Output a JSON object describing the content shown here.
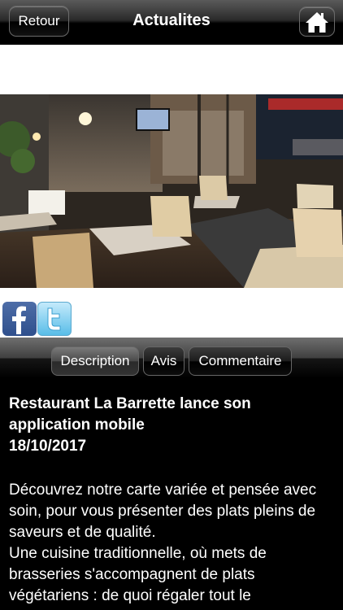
{
  "navbar": {
    "back_label": "Retour",
    "title": "Actualites",
    "home_icon": "home-icon"
  },
  "social": {
    "facebook_icon": "facebook-icon",
    "twitter_icon": "twitter-icon"
  },
  "tabs": [
    {
      "label": "Description",
      "active": true
    },
    {
      "label": "Avis",
      "active": false
    },
    {
      "label": "Commentaire",
      "active": false
    }
  ],
  "article": {
    "title": "Restaurant La Barrette lance son application mobile",
    "date": "18/10/2017",
    "body_1": "Découvrez notre carte variée et pensée avec soin, pour vous présenter des plats pleins de saveurs et de qualité.",
    "body_2": "Une cuisine traditionnelle, où mets de brasseries s'accompagnent de plats végétariens : de quoi régaler tout le"
  },
  "colors": {
    "background": "#000000",
    "text": "#ffffff",
    "facebook": "#3b5998",
    "twitter": "#59bde8"
  }
}
